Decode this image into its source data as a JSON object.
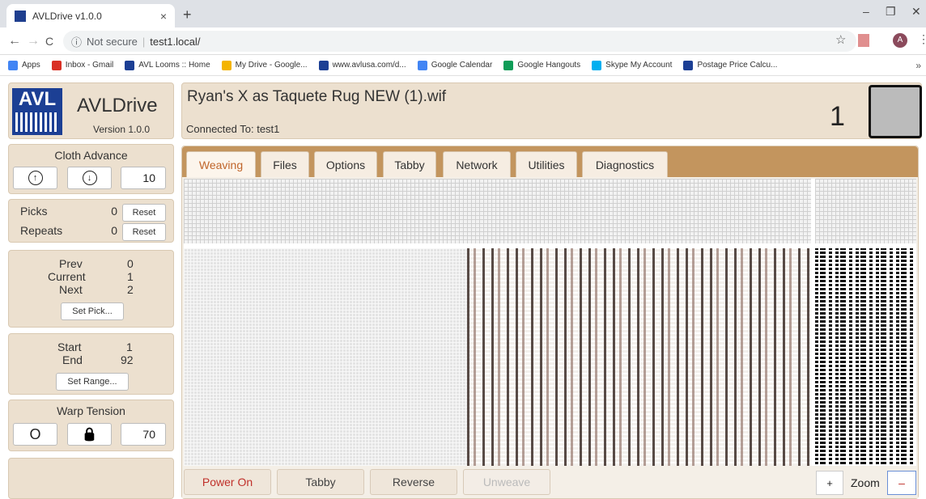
{
  "browser": {
    "tab_title": "AVLDrive v1.0.0",
    "tab_close": "×",
    "new_tab": "+",
    "url_secure_label": "Not secure",
    "url": "test1.local/",
    "avatar_letter": "A",
    "window": {
      "minimize": "–",
      "restore": "❐",
      "close": "✕"
    },
    "nav": {
      "back": "←",
      "forward": "→",
      "reload": "C"
    },
    "bookmarks": [
      {
        "label": "Apps",
        "color": "#4285f4"
      },
      {
        "label": "Inbox - Gmail",
        "color": "#d93025"
      },
      {
        "label": "AVL Looms :: Home",
        "color": "#1c3f94"
      },
      {
        "label": "My Drive - Google...",
        "color": "#f4b400"
      },
      {
        "label": "www.avlusa.com/d...",
        "color": "#1c3f94"
      },
      {
        "label": "Google Calendar",
        "color": "#4285f4"
      },
      {
        "label": "Google Hangouts",
        "color": "#0f9d58"
      },
      {
        "label": "Skype My Account",
        "color": "#00aff0"
      },
      {
        "label": "Postage Price Calcu...",
        "color": "#1c3f94"
      }
    ],
    "bookmarks_more": "»"
  },
  "header": {
    "logo_text": "AVL",
    "app_name": "AVLDrive",
    "version": "Version 1.0.0",
    "file_name": "Ryan's X as Taquete Rug NEW (1).wif",
    "connected": "Connected To: test1",
    "pick_display": "1"
  },
  "cloth_advance": {
    "title": "Cloth Advance",
    "up_icon": "↑",
    "down_icon": "↓",
    "value": "10"
  },
  "counters": {
    "picks_label": "Picks",
    "picks_value": "0",
    "repeats_label": "Repeats",
    "repeats_value": "0",
    "reset_label": "Reset"
  },
  "pick_nav": {
    "prev_label": "Prev",
    "prev_value": "0",
    "current_label": "Current",
    "current_value": "1",
    "next_label": "Next",
    "next_value": "2",
    "set_pick_label": "Set Pick..."
  },
  "range": {
    "start_label": "Start",
    "start_value": "1",
    "end_label": "End",
    "end_value": "92",
    "set_range_label": "Set Range..."
  },
  "warp_tension": {
    "title": "Warp Tension",
    "refresh_icon": "O",
    "lock_icon": "🔒",
    "value": "70"
  },
  "tabs": [
    "Weaving",
    "Files",
    "Options",
    "Tabby",
    "Network",
    "Utilities",
    "Diagnostics"
  ],
  "bottom": {
    "power_on": "Power On",
    "tabby": "Tabby",
    "reverse": "Reverse",
    "unweave": "Unweave",
    "zoom_plus": "+",
    "zoom_label": "Zoom",
    "zoom_minus": "–"
  },
  "colors": {
    "accent_tab": "#c0652a",
    "tab_strip": "#c3955e",
    "panel_bg": "#ece0cf",
    "power_text": "#c0302a",
    "logo_blue": "#1c3f94"
  }
}
